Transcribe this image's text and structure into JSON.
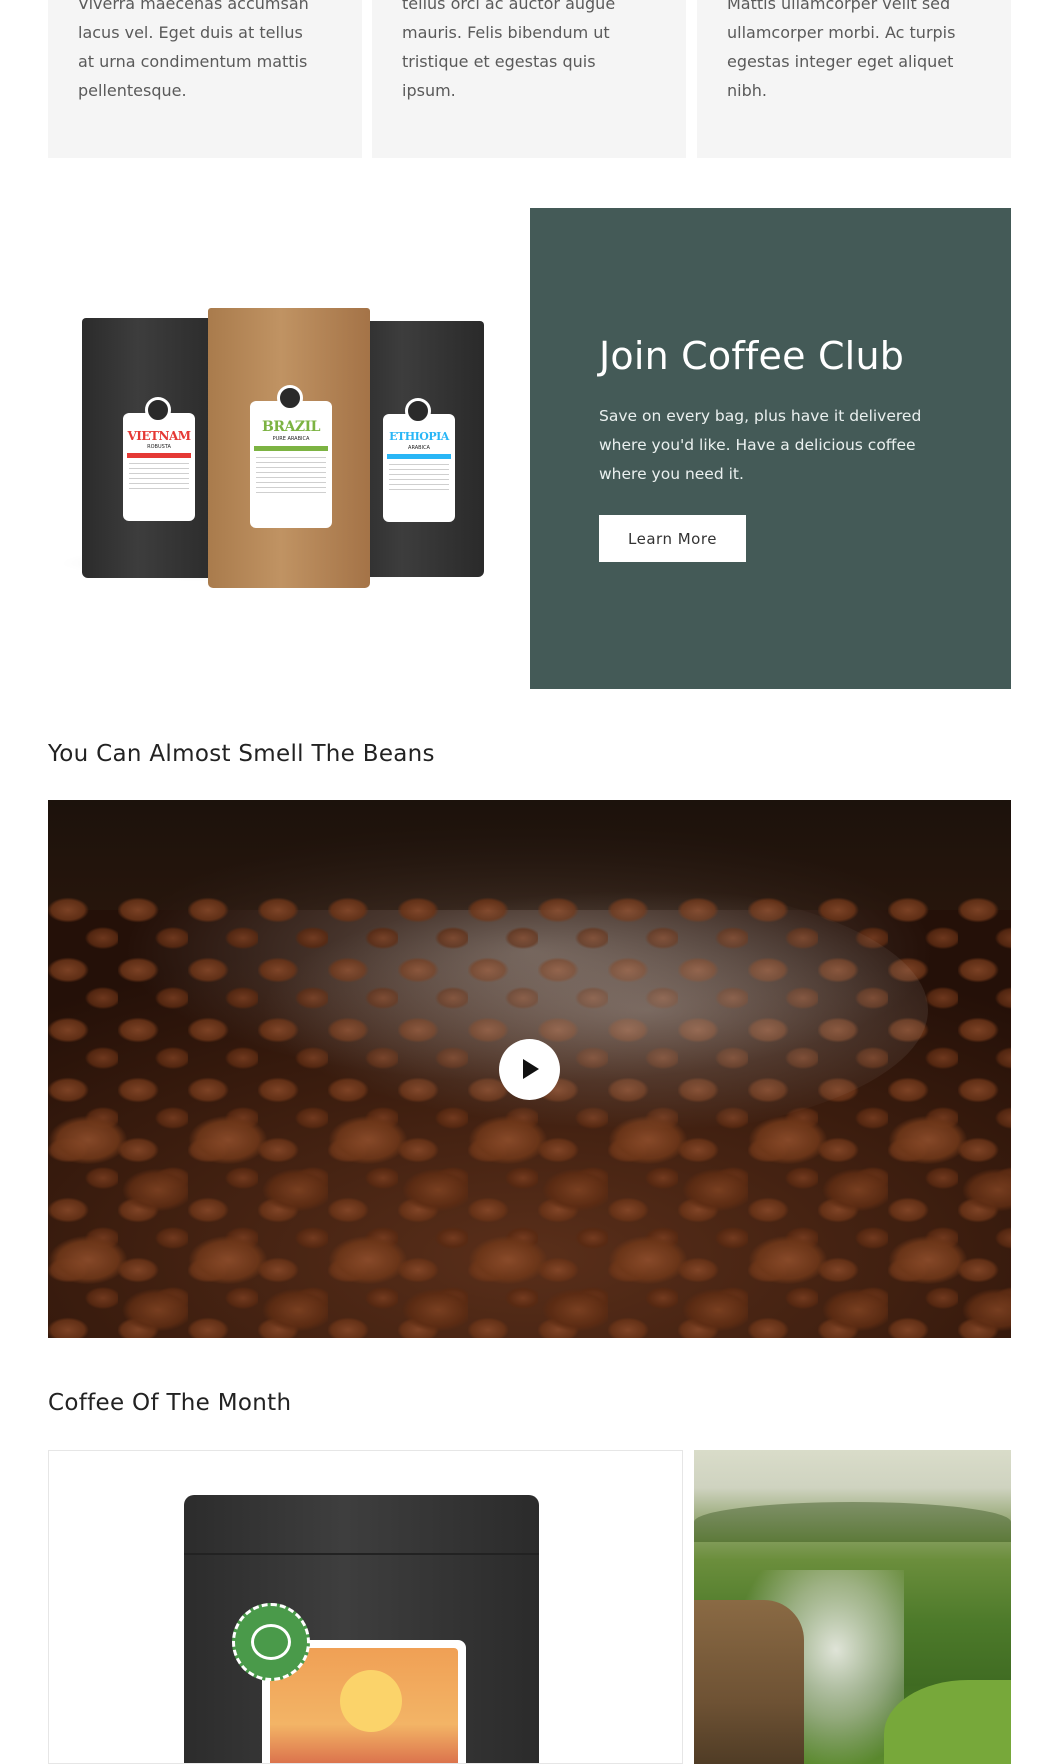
{
  "feature_cards": [
    {
      "text": "Viverra maecenas accumsan lacus vel. Eget duis at tellus at urna condimentum mattis pellentesque."
    },
    {
      "text": "tellus orci ac auctor augue mauris. Felis bibendum ut tristique et egestas quis ipsum."
    },
    {
      "text": "Mattis ullamcorper velit sed ullamcorper morbi. Ac turpis egestas integer eget aliquet nibh."
    }
  ],
  "coffee_club": {
    "bags": [
      {
        "name": "VIETNAM",
        "sub": "ROBUSTA",
        "accent": "#e53935"
      },
      {
        "name": "BRAZIL",
        "sub": "PURE ARABICA",
        "accent": "#7cb342"
      },
      {
        "name": "ETHIOPIA",
        "sub": "ARABICA",
        "accent": "#29b6f6"
      }
    ],
    "title": "Join Coffee Club",
    "text": "Save on every bag, plus have it delivered where you'd like. Have a delicious coffee where you need it.",
    "button_label": "Learn More",
    "panel_color": "#445a57"
  },
  "video_section": {
    "heading": "You Can Almost Smell The Beans",
    "play_icon": "play-icon"
  },
  "month_section": {
    "heading": "Coffee Of The Month"
  }
}
